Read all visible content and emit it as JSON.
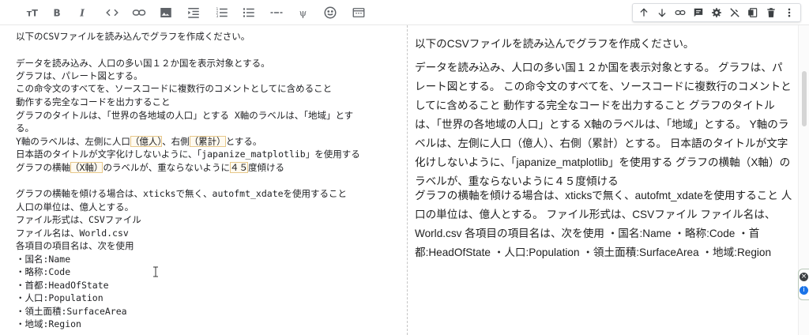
{
  "toolbar": {
    "buttons": [
      {
        "name": "text-size-icon",
        "title": "Heading"
      },
      {
        "name": "bold-icon",
        "title": "Bold"
      },
      {
        "name": "italic-icon",
        "title": "Italic"
      },
      {
        "name": "code-icon",
        "title": "Code"
      },
      {
        "name": "link-icon",
        "title": "Link"
      },
      {
        "name": "image-icon",
        "title": "Image"
      },
      {
        "name": "indent-icon",
        "title": "Indent"
      },
      {
        "name": "numbered-list-icon",
        "title": "Numbered list"
      },
      {
        "name": "bulleted-list-icon",
        "title": "Bulleted list"
      },
      {
        "name": "horizontal-rule-icon",
        "title": "Horizontal rule"
      },
      {
        "name": "psi-icon",
        "title": "LaTeX"
      },
      {
        "name": "emoji-icon",
        "title": "Emoji"
      },
      {
        "name": "preview-toggle-icon",
        "title": "Preview"
      }
    ]
  },
  "cell_toolbar": {
    "buttons": [
      {
        "name": "move-up-icon",
        "title": "Move cell up"
      },
      {
        "name": "move-down-icon",
        "title": "Move cell down"
      },
      {
        "name": "link-cell-icon",
        "title": "Copy link to cell"
      },
      {
        "name": "comment-icon",
        "title": "Add comment"
      },
      {
        "name": "settings-icon",
        "title": "Editor settings"
      },
      {
        "name": "edit-off-icon",
        "title": "Close editor"
      },
      {
        "name": "mirror-cell-icon",
        "title": "Mirror cell in tab"
      },
      {
        "name": "delete-icon",
        "title": "Delete cell"
      },
      {
        "name": "more-vert-icon",
        "title": "More actions"
      }
    ]
  },
  "editor": {
    "lines": [
      "以下のCSVファイルを読み込んでグラフを作成ください。",
      "",
      "データを読み込み、人口の多い国１２か国を表示対象とする。",
      "グラフは、パレート図とする。",
      "この命令文のすべてを、ソースコードに複数行のコメントとしてに含めること",
      "動作する完全なコードを出力すること",
      "グラフのタイトルは、「世界の各地域の人口」とする X軸のラベルは、「地域」とす",
      "る。",
      "Y軸のラベルは、左側に人口（億人）、右側（累計）とする。",
      "日本語のタイトルが文字化けしないように、「japanize_matplotlib」を使用する",
      "グラフの横軸（X軸）のラベルが、重ならないように４５度傾ける",
      "",
      "グラフの横軸を傾ける場合は、xticksで無く、autofmt_xdateを使用すること",
      "人口の単位は、億人とする。",
      "ファイル形式は、CSVファイル",
      "ファイル名は、World.csv",
      "各項目の項目名は、次を使用",
      "・国名:Name",
      "・略称:Code",
      "・首都:HeadOfState",
      "・人口:Population",
      "・領土面積:SurfaceArea",
      "・地域:Region"
    ]
  },
  "preview": {
    "paragraphs": [
      "以下のCSVファイルを読み込んでグラフを作成ください。",
      "データを読み込み、人口の多い国１２か国を表示対象とする。 グラフは、パレート図とする。 この命令文のすべてを、ソースコードに複数行のコメントとしてに含めること 動作する完全なコードを出力すること グラフのタイトルは、「世界の各地域の人口」とする X軸のラベルは、「地域」とする。 Y軸のラベルは、左側に人口（億人）、右側（累計）とする。 日本語のタイトルが文字化けしないように、「japanize_matplotlib」を使用する グラフの横軸（X軸）のラベルが、重ならないように４５度傾ける",
      "グラフの横軸を傾ける場合は、xticksで無く、autofmt_xdateを使用すること 人口の単位は、億人とする。 ファイル形式は、CSVファイル ファイル名は、World.csv 各項目の項目名は、次を使用 ・国名:Name ・略称:Code ・首都:HeadOfState ・人口:Population ・領土面積:SurfaceArea ・地域:Region"
    ]
  },
  "side_widget": {
    "top_icon": "close-icon",
    "bottom_icon": "info-icon"
  },
  "colors": {
    "highlight_outline": "#e7c88a",
    "side_green": "#1e8e3e",
    "side_blue": "#1a73e8"
  }
}
